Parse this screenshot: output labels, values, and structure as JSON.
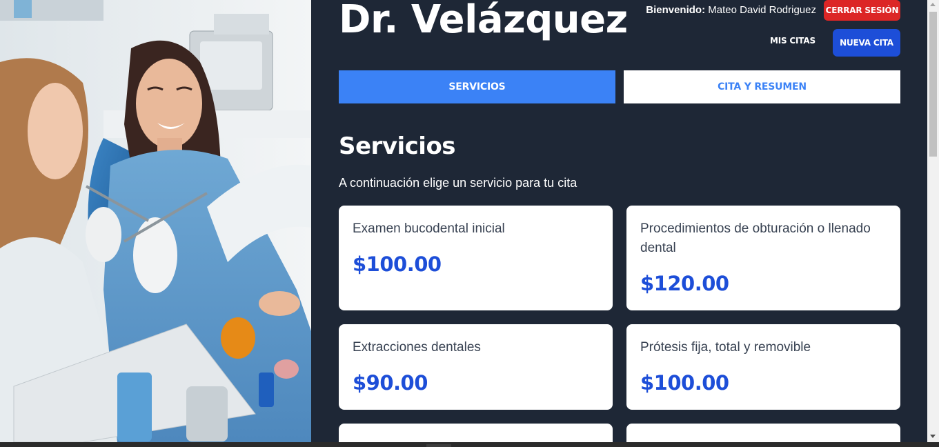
{
  "header": {
    "brand": "Dr. Velázquez",
    "welcome_label": "Bienvenido:",
    "user_name": "Mateo David Rodriguez",
    "logout_label": "CERRAR SESIÓN",
    "my_appointments_label": "MIS CITAS",
    "new_appointment_label": "NUEVA CITA"
  },
  "tabs": [
    {
      "label": "SERVICIOS",
      "active": true
    },
    {
      "label": "CITA Y RESUMEN",
      "active": false
    }
  ],
  "section": {
    "title": "Servicios",
    "description": "A continuación elige un servicio para tu cita"
  },
  "services": [
    {
      "name": "Examen bucodental inicial",
      "price": "$100.00"
    },
    {
      "name": "Procedimientos de obturación o llenado dental",
      "price": "$120.00"
    },
    {
      "name": "Extracciones dentales",
      "price": "$90.00"
    },
    {
      "name": "Prótesis fija, total y removible",
      "price": "$100.00"
    }
  ],
  "colors": {
    "background": "#1e2736",
    "accent": "#3b82f6",
    "primary_button": "#1d4ed8",
    "danger_button": "#dc2626",
    "price_text": "#1d4ed8"
  },
  "hero_image": {
    "icon": "dental-clinic-photo"
  }
}
